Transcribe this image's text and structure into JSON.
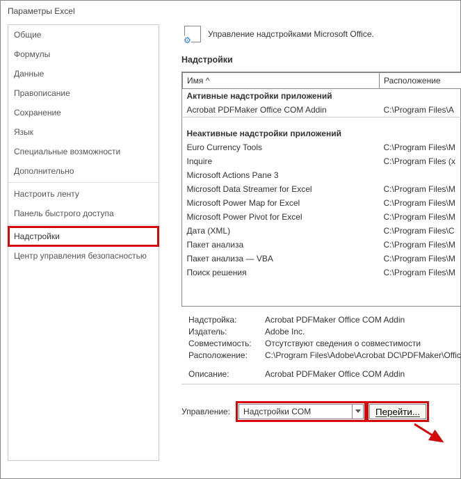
{
  "window_title": "Параметры Excel",
  "sidebar": {
    "groups": [
      [
        "Общие",
        "Формулы",
        "Данные",
        "Правописание",
        "Сохранение",
        "Язык",
        "Специальные возможности",
        "Дополнительно"
      ],
      [
        "Настроить ленту",
        "Панель быстрого доступа"
      ],
      [
        "Надстройки",
        "Центр управления безопасностью"
      ]
    ],
    "selected": "Надстройки"
  },
  "header_text": "Управление надстройками Microsoft Office.",
  "section_title": "Надстройки",
  "table": {
    "columns": [
      "Имя ^",
      "Расположение"
    ],
    "groups": [
      {
        "title": "Активные надстройки приложений",
        "rows": [
          {
            "name": "Acrobat PDFMaker Office COM Addin",
            "loc": "C:\\Program Files\\A"
          }
        ]
      },
      {
        "title": "Неактивные надстройки приложений",
        "rows": [
          {
            "name": "Euro Currency Tools",
            "loc": "C:\\Program Files\\M"
          },
          {
            "name": "Inquire",
            "loc": "C:\\Program Files (x"
          },
          {
            "name": "Microsoft Actions Pane 3",
            "loc": ""
          },
          {
            "name": "Microsoft Data Streamer for Excel",
            "loc": "C:\\Program Files\\M"
          },
          {
            "name": "Microsoft Power Map for Excel",
            "loc": "C:\\Program Files\\M"
          },
          {
            "name": "Microsoft Power Pivot for Excel",
            "loc": "C:\\Program Files\\M"
          },
          {
            "name": "Дата (XML)",
            "loc": "C:\\Program Files\\C"
          },
          {
            "name": "Пакет анализа",
            "loc": "C:\\Program Files\\M"
          },
          {
            "name": "Пакет анализа — VBA",
            "loc": "C:\\Program Files\\M"
          },
          {
            "name": "Поиск решения",
            "loc": "C:\\Program Files\\M"
          }
        ]
      }
    ]
  },
  "details": {
    "labels": {
      "addin": "Надстройка:",
      "publisher": "Издатель:",
      "compat": "Совместимость:",
      "location": "Расположение:",
      "desc": "Описание:"
    },
    "values": {
      "addin": "Acrobat PDFMaker Office COM Addin",
      "publisher": "Adobe Inc.",
      "compat": "Отсутствуют сведения о совместимости",
      "location": "C:\\Program Files\\Adobe\\Acrobat DC\\PDFMaker\\Office\\",
      "desc": "Acrobat PDFMaker Office COM Addin"
    }
  },
  "manage": {
    "label": "Управление:",
    "combo_value": "Надстройки COM",
    "go_label": "Перейти..."
  }
}
